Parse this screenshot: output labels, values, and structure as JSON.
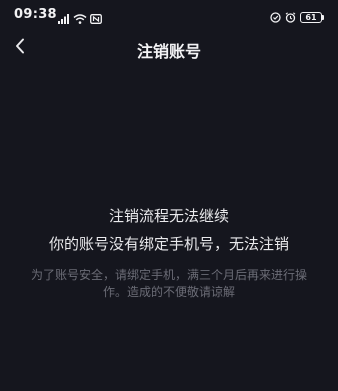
{
  "status_bar": {
    "time": "09:38",
    "battery_level": "61",
    "left_icons": [
      "signal-icon",
      "wifi-icon",
      "nfc-icon"
    ],
    "right_icons": [
      "sync-icon",
      "alarm-icon",
      "battery-icon"
    ]
  },
  "header": {
    "back_icon": "chevron-left-icon",
    "title": "注销账号"
  },
  "message": {
    "title": "注销流程无法继续",
    "subtitle": "你的账号没有绑定手机号，无法注销",
    "hint": "为了账号安全，请绑定手机，满三个月后再来进行操作。造成的不便敬请谅解"
  },
  "colors": {
    "background": "#15161e",
    "primary_text": "#e9e9ec",
    "hint_text": "#6b6c76"
  }
}
